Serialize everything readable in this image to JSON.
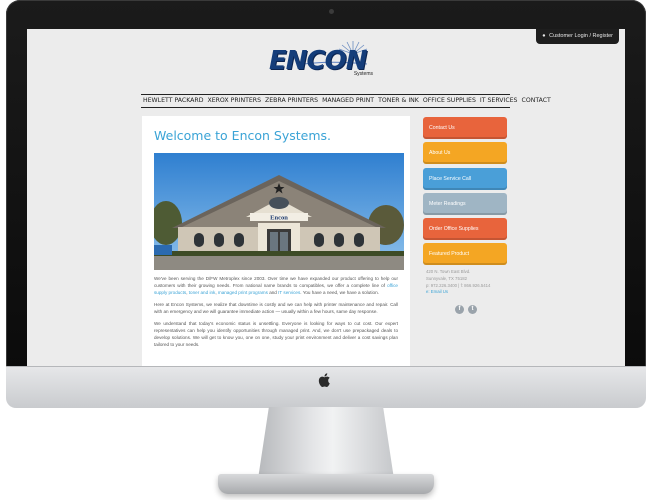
{
  "login": {
    "label": "Customer Login / Register",
    "icon": "lock-icon"
  },
  "logo": {
    "word": "ENCON",
    "sub": "Systems"
  },
  "nav": [
    "HEWLETT PACKARD",
    "XEROX PRINTERS",
    "ZEBRA PRINTERS",
    "MANAGED PRINT",
    "TONER & INK",
    "OFFICE SUPPLIES",
    "IT SERVICES",
    "CONTACT"
  ],
  "main": {
    "title": "Welcome to Encon Systems.",
    "building_sign": "Encon",
    "para1": {
      "a": "We've been serving the D/FW Metroplex since 2003. Over time we have expanded our product offering to help our customers with their growing needs. From national name brands to compatibles, we offer a complete line of ",
      "l1": "office supply products",
      "b": ", ",
      "l2": "toner and ink",
      "c": ", ",
      "l3": "managed print programs",
      "d": " and ",
      "l4": "IT services",
      "e": ". You have a need, we have a solution."
    },
    "para2": "Here at Encon Systems, we realize that downtime is costly and we can help with printer maintenance and repair. Call with an emergency and we will guarantee immediate action — usually within a few hours, same day response.",
    "para3": "We understand that today's economic status is unsettling. Everyone is looking for ways to cut cost. Our expert representatives can help you identify opportunities through managed print. And, we don't use prepackaged deals to develop solutions. We will get to know you, one on one, study your print environment and deliver a cost savings plan tailored to your needs."
  },
  "sidebar": {
    "buttons": [
      {
        "label": "Contact Us",
        "color": "#e8643c"
      },
      {
        "label": "About Us",
        "color": "#f4a623"
      },
      {
        "label": "Place Service Call",
        "color": "#4a9fd8"
      },
      {
        "label": "Meter Readings",
        "color": "#9fb5c4"
      },
      {
        "label": "Order Office Supplies",
        "color": "#e8643c"
      },
      {
        "label": "Featured Product",
        "color": "#f4a623"
      }
    ],
    "address": {
      "line1": "420 N. Town East Blvd.",
      "line2": "Sunnyvale, TX 75182",
      "phones": "p: 972.226.3400  |  f: 866.926.5414",
      "email": "e: Email Us"
    },
    "social": [
      {
        "icon": "facebook-icon",
        "glyph": "f"
      },
      {
        "icon": "twitter-icon",
        "glyph": "t"
      }
    ]
  }
}
